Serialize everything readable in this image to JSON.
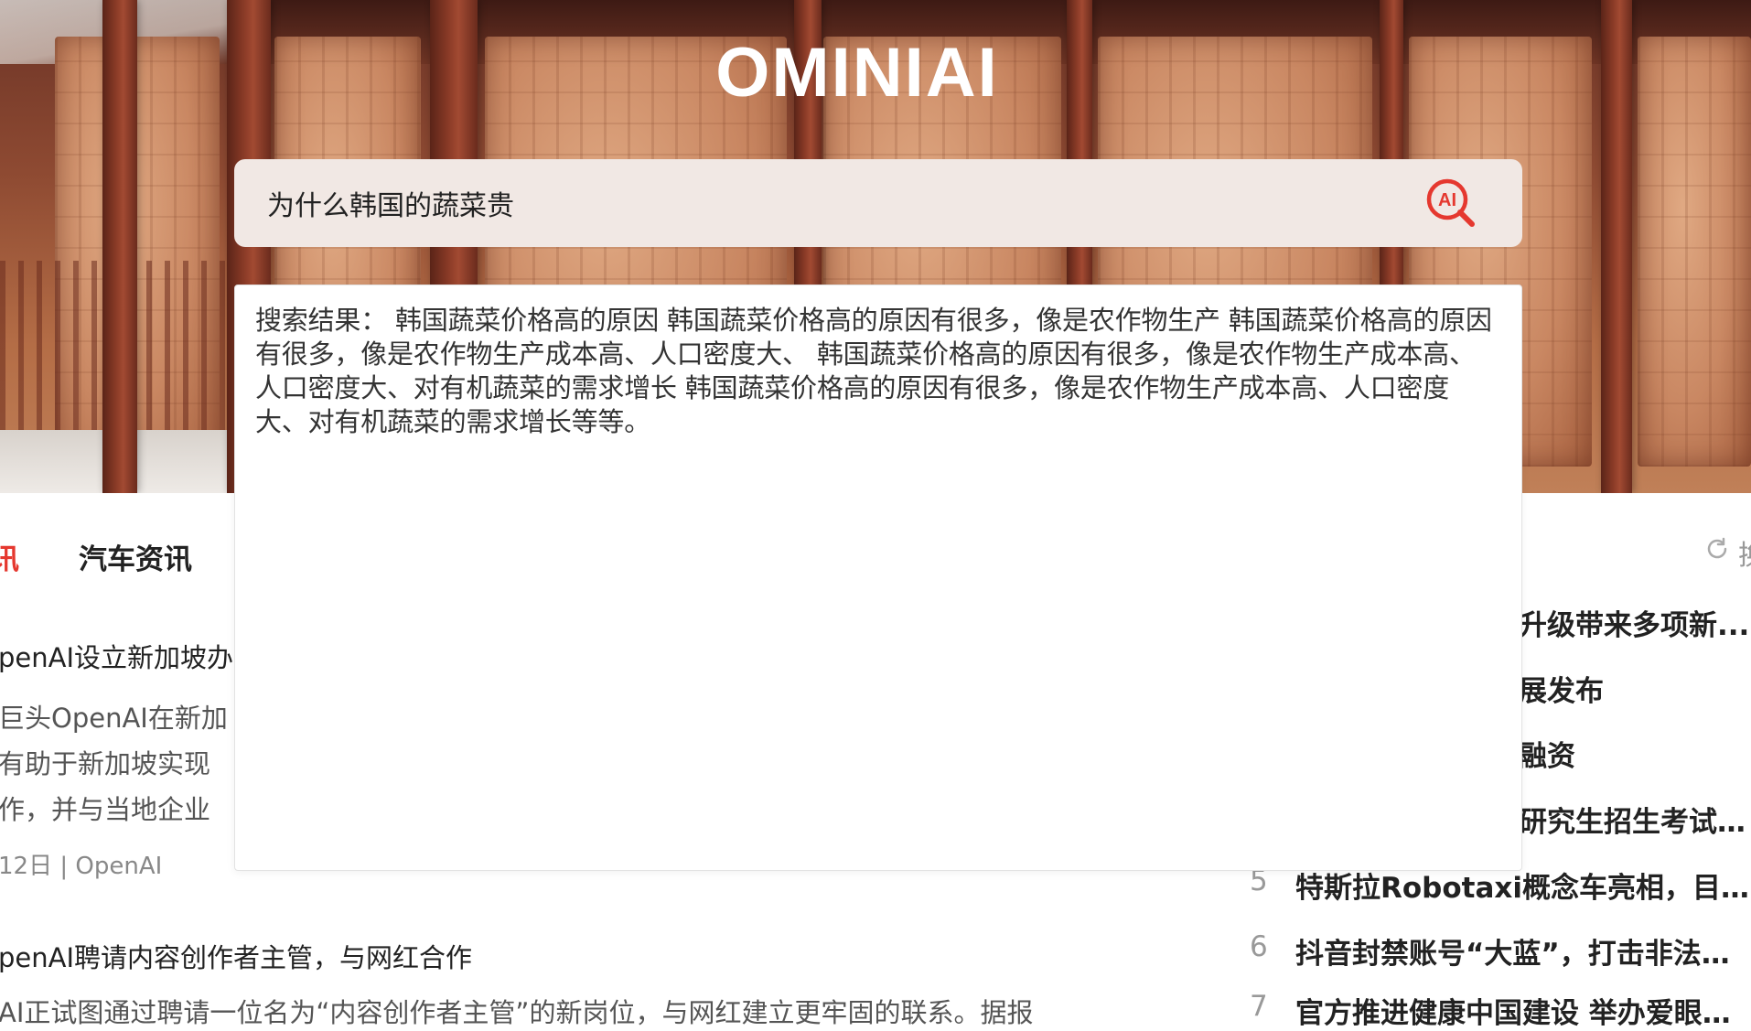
{
  "app": {
    "logo_text": "OMINIAI"
  },
  "search": {
    "query": "为什么韩国的蔬菜贵",
    "button_icon": "ai-search-icon",
    "accent": "#e5382f"
  },
  "results": {
    "text": "搜索结果： 韩国蔬菜价格高的原因 韩国蔬菜价格高的原因有很多，像是农作物生产 韩国蔬菜价格高的原因有很多，像是农作物生产成本高、人口密度大、 韩国蔬菜价格高的原因有很多，像是农作物生产成本高、人口密度大、对有机蔬菜的需求增长 韩国蔬菜价格高的原因有很多，像是农作物生产成本高、人口密度大、对有机蔬菜的需求增长等等。"
  },
  "news": {
    "tabs": [
      {
        "label": "讯",
        "active": true
      },
      {
        "label": "汽车资讯",
        "active": false
      }
    ],
    "refresh_label": "换",
    "articles": [
      {
        "title": "penAI设立新加坡办",
        "summary_lines": [
          "巨头OpenAI在新加",
          "有助于新加坡实现",
          "作，并与当地企业"
        ],
        "meta": "12日  | OpenAI"
      },
      {
        "title": "penAI聘请内容创作者主管，与网红合作",
        "summary_lines": [
          "AI正试图通过聘请一位名为“内容创作者主管”的新岗位，与网红建立更牢固的联系。据报"
        ]
      }
    ]
  },
  "hot_list": [
    {
      "rank": "",
      "title": "升级带来多项新..."
    },
    {
      "rank": "",
      "title": "展发布"
    },
    {
      "rank": "",
      "title": "融资"
    },
    {
      "rank": "",
      "title": "研究生招生考试报..."
    },
    {
      "rank": "5",
      "title": "特斯拉Robotaxi概念车亮相，目标..."
    },
    {
      "rank": "6",
      "title": "抖音封禁账号“大蓝”，打击非法荐..."
    },
    {
      "rank": "7",
      "title": "官方推进健康中国建设 举办爱眼宣..."
    }
  ]
}
